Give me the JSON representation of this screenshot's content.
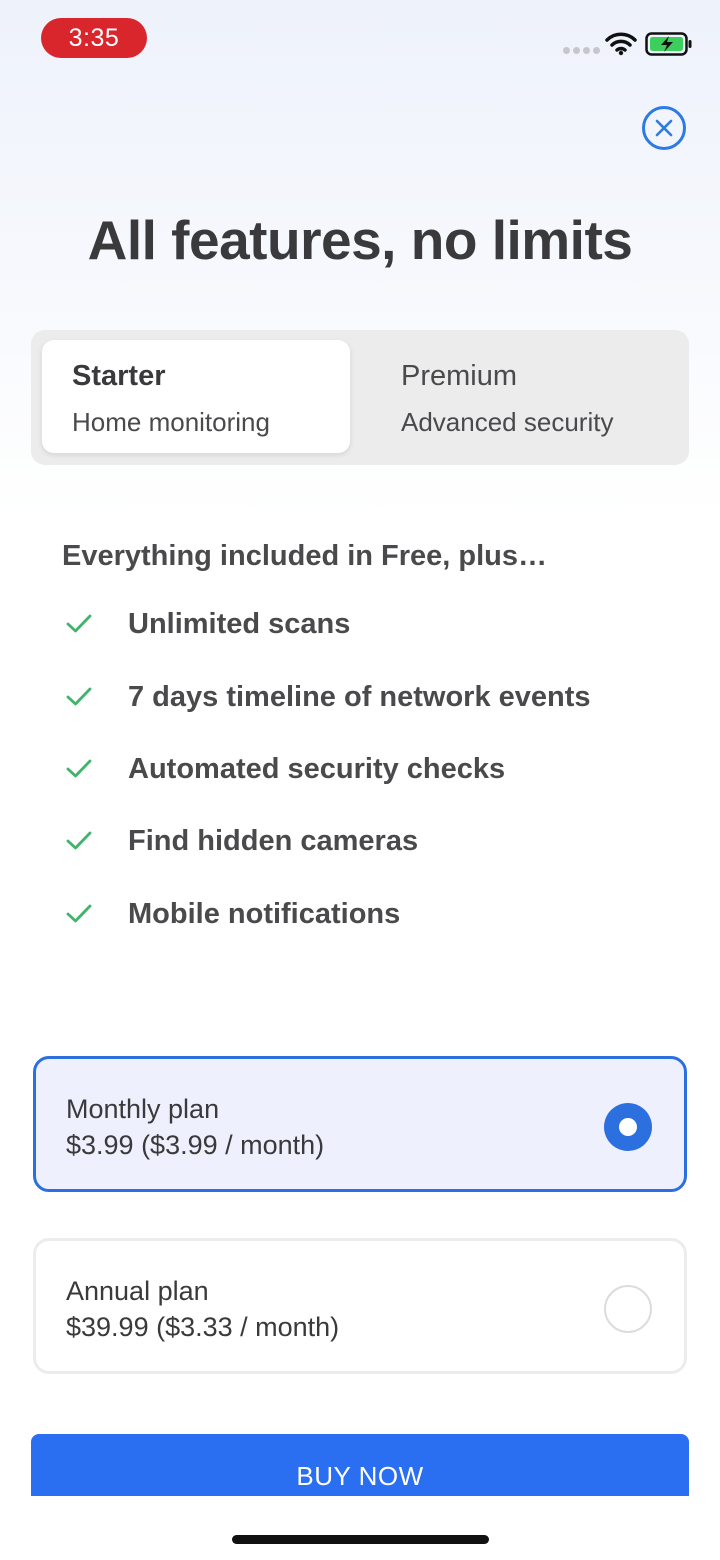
{
  "status_bar": {
    "time": "3:35"
  },
  "title": "All features, no limits",
  "tiers": [
    {
      "name": "Starter",
      "subtitle": "Home monitoring",
      "selected": true
    },
    {
      "name": "Premium",
      "subtitle": "Advanced security",
      "selected": false
    }
  ],
  "features": {
    "heading": "Everything included in Free, plus…",
    "items": [
      "Unlimited scans",
      "7 days timeline of network events",
      "Automated security checks",
      "Find hidden cameras",
      "Mobile notifications"
    ]
  },
  "plans": [
    {
      "name": "Monthly plan",
      "price": "$3.99 ($3.99 / month)",
      "selected": true
    },
    {
      "name": "Annual plan",
      "price": "$39.99 ($3.33 / month)",
      "selected": false
    }
  ],
  "buy_button": "BUY NOW",
  "colors": {
    "accent": "#2c6fdf",
    "button": "#2a6ef2",
    "check": "#3fb46b",
    "time_pill": "#d9262d"
  }
}
